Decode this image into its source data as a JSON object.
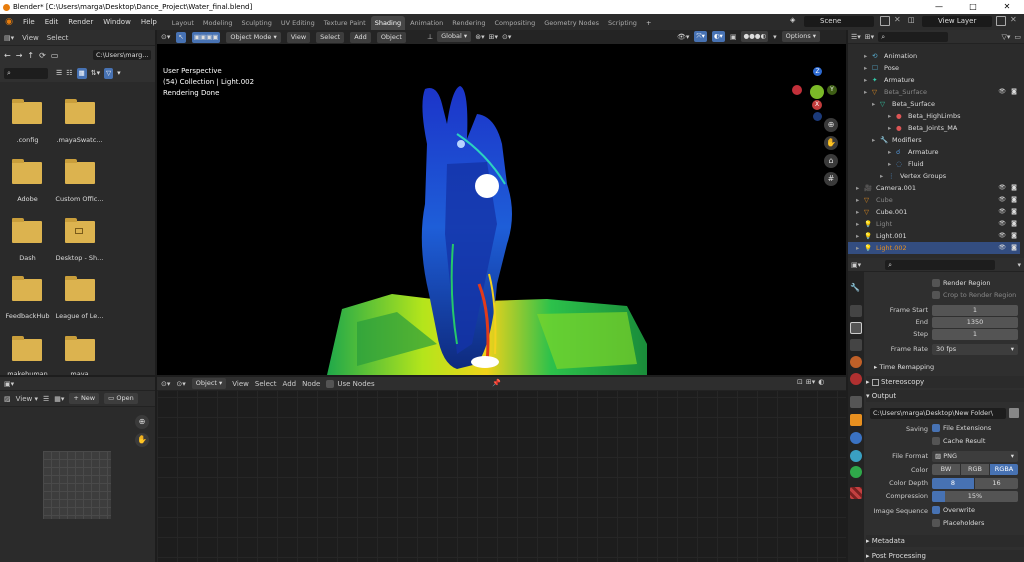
{
  "titlebar": {
    "title": "Blender* [C:\\Users\\marga\\Desktop\\Dance_Project\\Water_final.blend]",
    "minimize": "—",
    "maximize": "□",
    "close": "✕"
  },
  "menu": [
    "File",
    "Edit",
    "Render",
    "Window",
    "Help"
  ],
  "workspaces": [
    "Layout",
    "Modeling",
    "Sculpting",
    "UV Editing",
    "Texture Paint",
    "Shading",
    "Animation",
    "Rendering",
    "Compositing",
    "Geometry Nodes",
    "Scripting"
  ],
  "active_workspace": "Shading",
  "scene": {
    "name": "Scene",
    "view_layer": "View Layer"
  },
  "filebrowser": {
    "header": {
      "view": "View",
      "select": "Select"
    },
    "path": "C:\\Users\\marg...",
    "items": [
      {
        "label": ".config"
      },
      {
        "label": ".mayaSwatc..."
      },
      {
        "label": "Adobe"
      },
      {
        "label": "Custom Offic..."
      },
      {
        "label": "Dash"
      },
      {
        "label": "Desktop - Sh..."
      },
      {
        "label": "FeedbackHub"
      },
      {
        "label": "League of Le..."
      },
      {
        "label": "makehuman"
      },
      {
        "label": "maya"
      }
    ]
  },
  "viewport": {
    "mode": "Object Mode",
    "menus": [
      "View",
      "Select",
      "Add",
      "Object"
    ],
    "transform": "Global",
    "options": "Options",
    "overlay_lines": [
      "User Perspective",
      "(54) Collection | Light.002",
      "Rendering Done"
    ],
    "gizmo": {
      "z": "Z",
      "y": "Y",
      "x": "X"
    }
  },
  "image_editor": {
    "view": "View",
    "new": "New",
    "open": "Open"
  },
  "node_editor": {
    "mode": "Object",
    "menus": [
      "View",
      "Select",
      "Add",
      "Node"
    ],
    "use_nodes": "Use Nodes"
  },
  "outliner": {
    "rows": [
      {
        "label": "Animation",
        "indent": 3
      },
      {
        "label": "Pose",
        "indent": 3
      },
      {
        "label": "Armature",
        "indent": 3
      },
      {
        "label": "Beta_Surface",
        "indent": 3,
        "dim": true
      },
      {
        "label": "Beta_Surface",
        "indent": 4
      },
      {
        "label": "Beta_HighLimbs",
        "indent": 6
      },
      {
        "label": "Beta_Joints_MA",
        "indent": 6
      },
      {
        "label": "Modifiers",
        "indent": 4
      },
      {
        "label": "Armature",
        "indent": 6
      },
      {
        "label": "Fluid",
        "indent": 6
      },
      {
        "label": "Vertex Groups",
        "indent": 5
      },
      {
        "label": "Camera.001",
        "indent": 2
      },
      {
        "label": "Cube",
        "indent": 2,
        "dim": true
      },
      {
        "label": "Cube.001",
        "indent": 2
      },
      {
        "label": "Light",
        "indent": 2,
        "dim": true
      },
      {
        "label": "Light.001",
        "indent": 2
      },
      {
        "label": "Light.002",
        "indent": 2,
        "selected": true
      }
    ]
  },
  "properties": {
    "render_region": "Render Region",
    "crop_region": "Crop to Render Region",
    "frame_start_label": "Frame Start",
    "frame_start": "1",
    "end_label": "End",
    "end": "1350",
    "step_label": "Step",
    "step": "1",
    "frame_rate_label": "Frame Rate",
    "frame_rate": "30 fps",
    "time_remapping": "Time Remapping",
    "stereoscopy": "Stereoscopy",
    "output": "Output",
    "output_path": "C:\\Users\\marga\\Desktop\\New Folder\\",
    "saving_label": "Saving",
    "file_extensions": "File Extensions",
    "cache_result": "Cache Result",
    "file_format_label": "File Format",
    "file_format": "PNG",
    "color_label": "Color",
    "color_opts": [
      "BW",
      "RGB",
      "RGBA"
    ],
    "color_depth_label": "Color Depth",
    "depth_opts": [
      "8",
      "16"
    ],
    "compression_label": "Compression",
    "compression": "15%",
    "compression_value": 0.15,
    "image_sequence_label": "Image Sequence",
    "overwrite": "Overwrite",
    "placeholders": "Placeholders",
    "metadata": "Metadata",
    "post_processing": "Post Processing"
  }
}
